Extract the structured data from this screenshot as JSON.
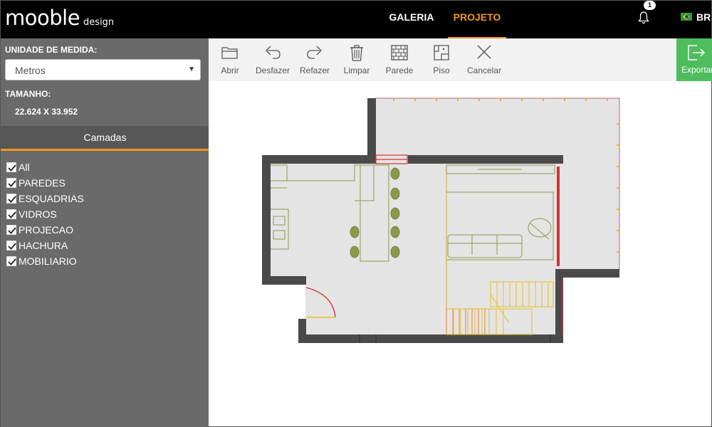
{
  "header": {
    "logo_main": "mooble",
    "logo_sub": "design",
    "nav": [
      "GALERIA",
      "PROJETO"
    ],
    "notifications": "1",
    "language": "BR"
  },
  "sidebar": {
    "unit_label": "UNIDADE DE MEDIDA:",
    "unit_value": "Metros",
    "size_label": "TAMANHO:",
    "size_value": "22.624 X 33.952",
    "layers_title": "Camadas",
    "layers": [
      {
        "label": "All",
        "checked": true
      },
      {
        "label": "PAREDES",
        "checked": true
      },
      {
        "label": "ESQUADRIAS",
        "checked": true
      },
      {
        "label": "VIDROS",
        "checked": true
      },
      {
        "label": "PROJECAO",
        "checked": true
      },
      {
        "label": "HACHURA",
        "checked": true
      },
      {
        "label": "MOBILIARIO",
        "checked": true
      }
    ]
  },
  "toolbar": {
    "tools": [
      {
        "label": "Abrir",
        "icon": "folder-icon"
      },
      {
        "label": "Desfazer",
        "icon": "undo-icon"
      },
      {
        "label": "Refazer",
        "icon": "redo-icon"
      },
      {
        "label": "Limpar",
        "icon": "trash-icon"
      },
      {
        "label": "Parede",
        "icon": "brick-wall-icon"
      },
      {
        "label": "Piso",
        "icon": "floor-icon"
      },
      {
        "label": "Cancelar",
        "icon": "close-icon"
      }
    ],
    "export_label": "Exportar"
  },
  "colors": {
    "accent": "#f7941d",
    "export": "#4dbd5e",
    "sidebar": "#6a6a6a",
    "wall": "#4a4a4a",
    "furniture": "#8a9a4a",
    "stairs": "#e8c020",
    "window": "#d83030"
  }
}
